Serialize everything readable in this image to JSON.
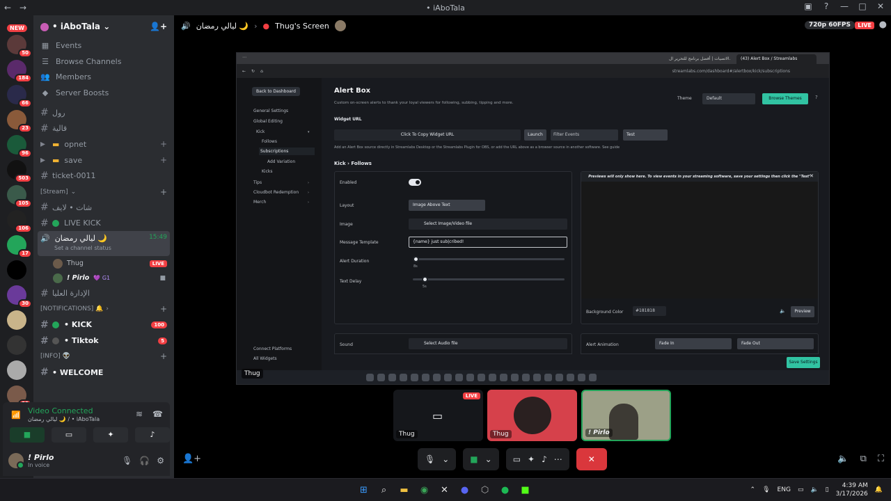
{
  "window": {
    "title": "• iAboTala"
  },
  "guild_badges": [
    "50",
    "184",
    "66",
    "23",
    "96",
    "503",
    "105",
    "106",
    "17",
    "30",
    "29"
  ],
  "guild_new": "NEW",
  "server": {
    "name": "• iAboTala"
  },
  "top_links": [
    "Events",
    "Browse Channels",
    "Members",
    "Server Boosts"
  ],
  "channels": {
    "c1": "رول",
    "c2": "قالية",
    "cat_opnet": "opnet",
    "cat_save": "save",
    "ticket": "ticket-0011",
    "cat_stream": "[Stream]",
    "c_live_life": "شات • لايف",
    "live_kick": "LIVE KICK",
    "voice_room": "ليالي رمضان 🌙",
    "voice_time": "15:49",
    "voice_status": "Set a channel status",
    "user_thug": "Thug",
    "user_thug_badge": "LIVE",
    "user_pirlo": "! Pirlo",
    "user_pirlo_tag": "💜 G1",
    "admin": "الإدارة العليا",
    "cat_notif": "[NOTIFICATIONS] 🔔",
    "kick": "• KICK",
    "kick_count": "100",
    "tiktok": "• Tiktok",
    "tiktok_count": "5",
    "cat_info": "[INFO] 👽",
    "welcome": "• WELCOME"
  },
  "voice_panel": {
    "status": "Video Connected",
    "sub": "ليالي رمضان 🌙 / • iAboTala"
  },
  "user": {
    "name": "! Pirlo",
    "status": "In voice"
  },
  "stage": {
    "channel": "ليالي رمضان 🌙",
    "screen_title": "Thug's Screen",
    "quality": "720p 60FPS",
    "live": "LIVE"
  },
  "browser": {
    "tabs": [
      "الاتصيات | أفضل برنامج للتحرير ال...",
      "(43) Alert Box / Streamlabs"
    ],
    "url": "streamlabs.com/dashboard#/alertbox/kick/subscriptions"
  },
  "streamlabs": {
    "back": "Back to Dashboard",
    "nav": [
      "General Settings",
      "Global Editing",
      "Kick",
      "Follows",
      "Subscriptions",
      "Add Variation",
      "Kicks",
      "Tips",
      "Cloudbot Redemption",
      "Merch"
    ],
    "bottom_nav": [
      "Connect Platforms",
      "All Widgets"
    ],
    "title": "Alert Box",
    "desc": "Custom on-screen alerts to thank your loyal viewers for following, subbing, tipping and more.",
    "theme_label": "Theme",
    "theme_value": "Default",
    "browse_themes": "Browse Themes",
    "widget_url_label": "Widget URL",
    "copy_widget": "Click To Copy Widget URL",
    "launch": "Launch",
    "filter_events": "Filter Events",
    "test": "Test",
    "url_note": "Add an Alert Box source directly in Streamlabs Desktop or the Streamlabs Plugin for OBS, or add the URL above as a browser source in another software. See guide",
    "section": "Kick › Follows",
    "enabled": "Enabled",
    "layout": "Layout",
    "layout_value": "Image Above Text",
    "image": "Image",
    "image_value": "Select Image/Video file",
    "message_template": "Message Template",
    "message_value": "{name} just sub|cribed!",
    "alert_duration": "Alert Duration",
    "alert_duration_value": "8s",
    "alert_duration_fraction": 0.02,
    "text_delay": "Text Delay",
    "text_delay_value": "5s",
    "text_delay_fraction": 0.08,
    "preview_note": "Previews will only show here. To view events in your streaming software, save your settings then click the \"Test\" button above.",
    "bg_color_label": "Background Color",
    "bg_color_value": "#181818",
    "preview": "Preview",
    "sound": "Sound",
    "sound_value": "Select Audio file",
    "alert_animation": "Alert Animation",
    "anim_in": "Fade In",
    "anim_out": "Fade Out",
    "save": "Save Settings",
    "accent": "#31c3a2"
  },
  "share_name": "Thug",
  "tiles": [
    {
      "name": "Thug",
      "live": "LIVE"
    },
    {
      "name": "Thug"
    },
    {
      "name": "! Pirlo"
    }
  ],
  "taskbar": {
    "lang": "ENG",
    "time": "4:39 AM",
    "date": "3/17/2026"
  }
}
